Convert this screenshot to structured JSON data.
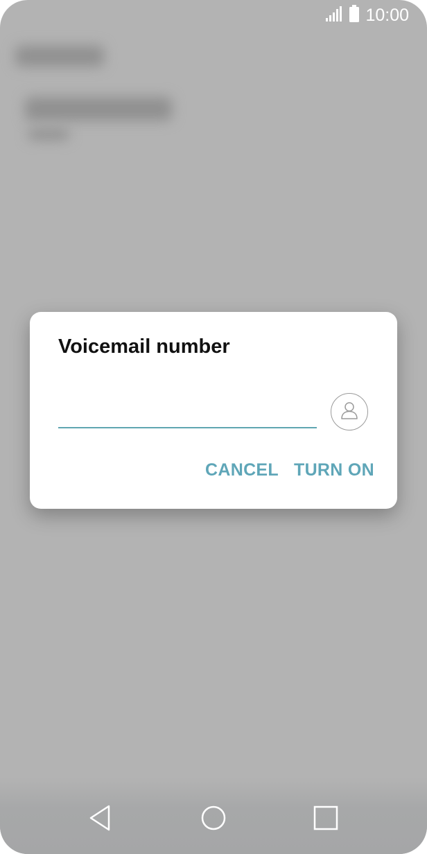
{
  "status_bar": {
    "time": "10:00",
    "signal_icon": "signal-icon",
    "battery_icon": "battery-icon"
  },
  "dialog": {
    "title": "Voicemail number",
    "input": {
      "value": "",
      "placeholder": ""
    },
    "contact_icon": "contact-icon",
    "cancel_label": "CANCEL",
    "confirm_label": "TURN ON",
    "accent_color": "#5fa6b8"
  },
  "nav_bar": {
    "back_icon": "back-icon",
    "home_icon": "home-icon",
    "recents_icon": "recents-icon"
  }
}
